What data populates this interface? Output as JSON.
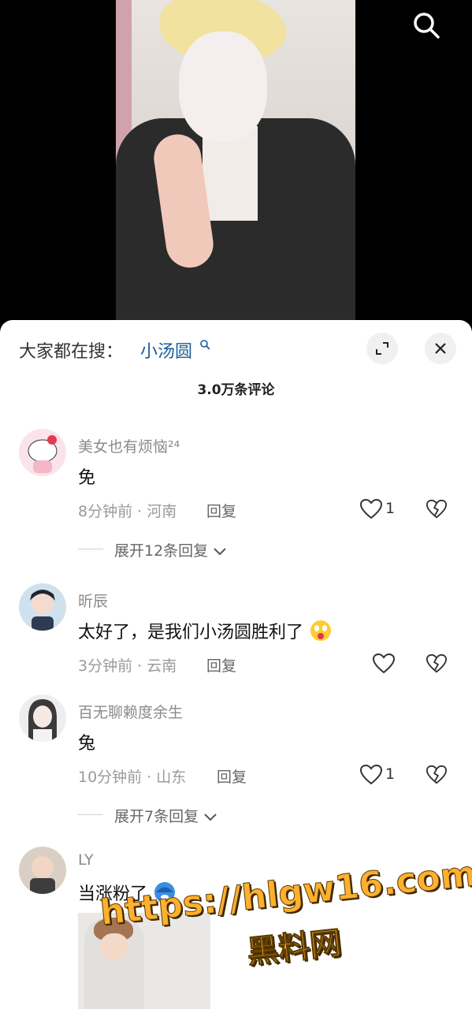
{
  "top_bar": {
    "search_icon": "search-icon"
  },
  "header": {
    "search_label": "大家都在搜：",
    "search_term": "小汤圆",
    "search_term_icon": "magnifier-small-icon",
    "expand_icon": "expand-icon",
    "close_icon": "close-icon"
  },
  "comments_count": "3.0万条评论",
  "comments": [
    {
      "username": "美女也有烦恼²⁴",
      "text": "免",
      "time_location": "8分钟前 · 河南",
      "reply_label": "回复",
      "likes": "1",
      "expand": "展开12条回复"
    },
    {
      "username": "昕辰",
      "text": "太好了，是我们小汤圆胜利了",
      "time_location": "3分钟前 · 云南",
      "reply_label": "回复",
      "likes": ""
    },
    {
      "username": "百无聊赖度余生",
      "text": "兔",
      "time_location": "10分钟前 · 山东",
      "reply_label": "回复",
      "likes": "1",
      "expand": "展开7条回复"
    },
    {
      "username": "LY",
      "text": "当涨粉了"
    }
  ],
  "watermark": {
    "url": "https://hlgw16.com",
    "name": "黑料网"
  }
}
